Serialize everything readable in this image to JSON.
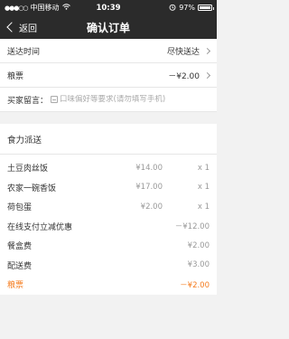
{
  "status_bar": {
    "carrier": "中国移动",
    "time": "10:39",
    "battery": "97%",
    "battery_level": 0.97,
    "signal_glyph": "●●●○○",
    "icons": [
      "signal-icon",
      "wifi-icon",
      "alarm-icon",
      "battery-icon"
    ]
  },
  "nav": {
    "back_label": "返回",
    "title": "确认订单"
  },
  "order_info": {
    "delivery_time": {
      "label": "送达时间",
      "value": "尽快送达"
    },
    "ticket": {
      "label": "粮票",
      "value": "－¥2.00"
    },
    "note": {
      "label": "买家留言：",
      "placeholder": "口味偏好等要求(请勿填写手机)"
    }
  },
  "shop": {
    "name": "食力派送",
    "items": [
      {
        "name": "土豆肉丝饭",
        "price": "¥14.00",
        "qty": "x 1"
      },
      {
        "name": "农家一碗香饭",
        "price": "¥17.00",
        "qty": "x 1"
      },
      {
        "name": "荷包蛋",
        "price": "¥2.00",
        "qty": "x 1"
      }
    ],
    "fees": [
      {
        "name": "在线支付立减优惠",
        "amount": "－¥12.00"
      },
      {
        "name": "餐盒费",
        "amount": "¥2.00"
      },
      {
        "name": "配送费",
        "amount": "¥3.00"
      }
    ],
    "ticket_discount": {
      "name": "粮票",
      "amount": "－¥2.00"
    }
  },
  "colors": {
    "header_bg": "#2b2b2b",
    "accent_orange": "#f57c1f",
    "muted_text": "#999999",
    "page_bg": "#f2f2f2"
  }
}
